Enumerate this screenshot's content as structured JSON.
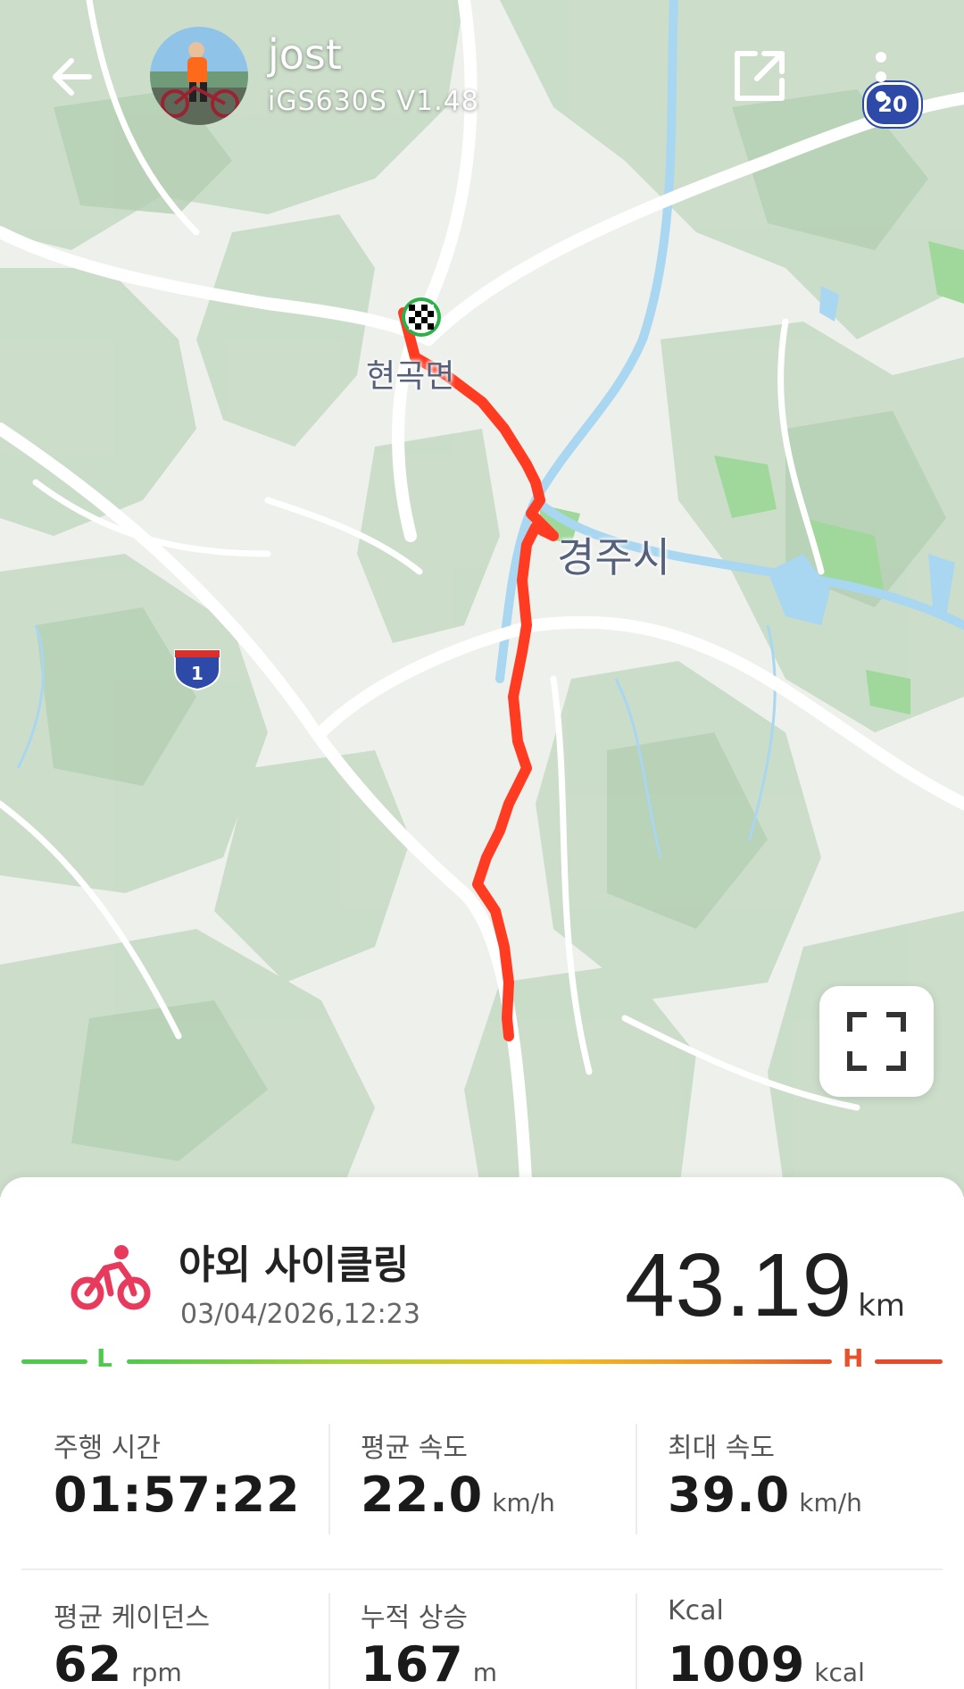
{
  "header": {
    "user_name": "jost",
    "device": "iGS630S  V1.48"
  },
  "map": {
    "town_label": "현곡면",
    "city_label": "경주시",
    "highway_number": "1",
    "route_number": "20",
    "route_color": "#ff3b22"
  },
  "activity": {
    "name": "야외 사이클링",
    "datetime": "03/04/2026,12:23",
    "distance_value": "43.19",
    "distance_unit": "km",
    "icon_color": "#e83a5c"
  },
  "intensity": {
    "low_label": "L",
    "high_label": "H"
  },
  "stats": [
    {
      "label": "주행 시간",
      "value": "01:57:22",
      "unit": ""
    },
    {
      "label": "평균 속도",
      "value": "22.0",
      "unit": "km/h"
    },
    {
      "label": "최대 속도",
      "value": "39.0",
      "unit": "km/h"
    },
    {
      "label": "평균 케이던스",
      "value": "62",
      "unit": "rpm"
    },
    {
      "label": "누적 상승",
      "value": "167",
      "unit": "m"
    },
    {
      "label": "Kcal",
      "value": "1009",
      "unit": "kcal"
    }
  ]
}
